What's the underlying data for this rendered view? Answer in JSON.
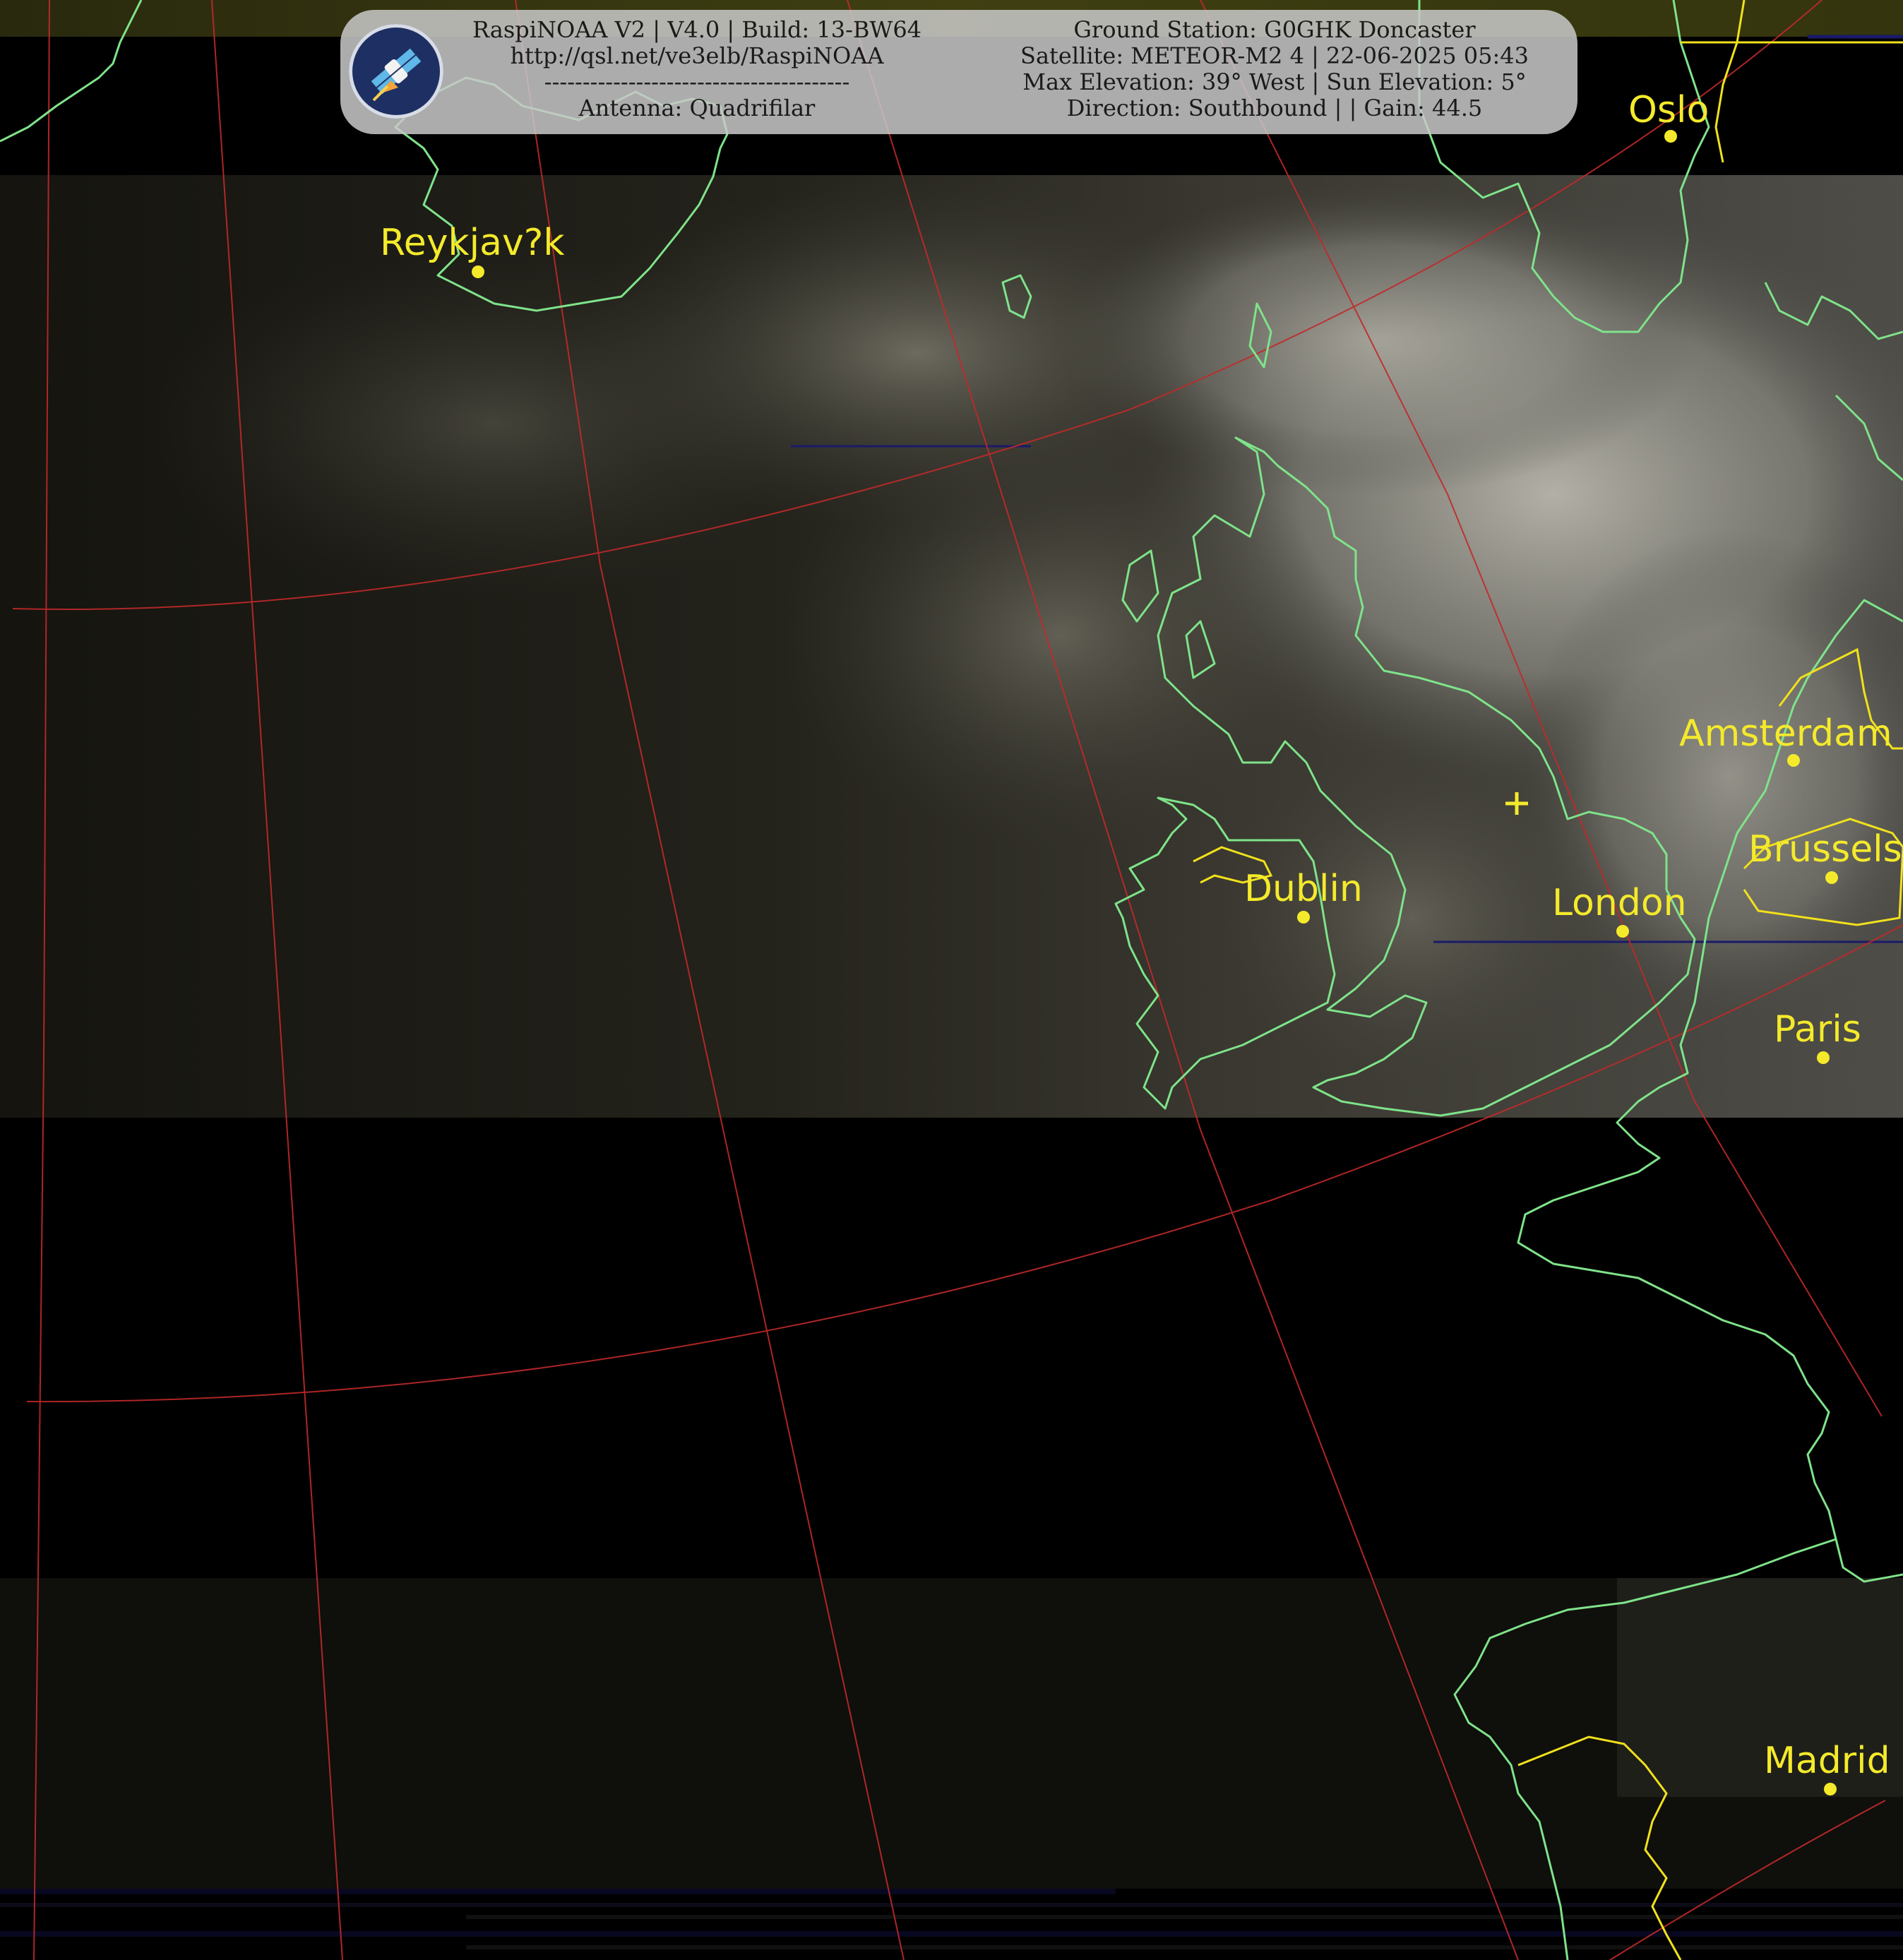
{
  "banner": {
    "left_lines": [
      "RaspiNOAA V2 | V4.0 | Build: 13-BW64",
      "http://qsl.net/ve3elb/RaspiNOAA",
      "----------------------------------------",
      "Antenna: Quadrifilar"
    ],
    "right_lines": [
      "Ground Station: G0GHK Doncaster",
      "Satellite: METEOR-M2 4 | 22-06-2025 05:43",
      "Max Elevation: 39° West | Sun Elevation: 5°",
      "Direction: Southbound | | Gain: 44.5"
    ],
    "logo_icon": "satellite-icon"
  },
  "cities": [
    "Oslo",
    "Reykjav?k",
    "Amsterdam",
    "Brussels",
    "Dublin",
    "London",
    "Paris",
    "Madrid"
  ],
  "colors": {
    "coastline": "#7fe38a",
    "border": "#f1e11c",
    "graticule": "#c02a2a",
    "city_label": "#f4ea2b",
    "banner_bg": "#c8c8c8"
  }
}
